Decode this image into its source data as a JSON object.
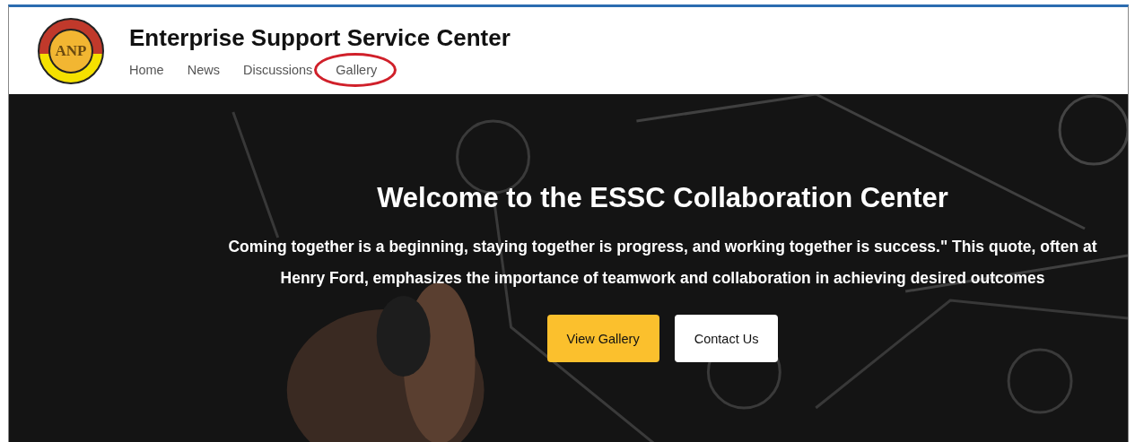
{
  "header": {
    "logo_text": "ANP",
    "title": "Enterprise Support Service Center"
  },
  "nav": [
    {
      "label": "Home",
      "selected": false,
      "circled": false
    },
    {
      "label": "News",
      "selected": false,
      "circled": false
    },
    {
      "label": "Discussions",
      "selected": false,
      "circled": false
    },
    {
      "label": "Gallery",
      "selected": false,
      "circled": true
    }
  ],
  "hero": {
    "kind": "picture",
    "title": "Welcome to the ESSC Collaboration Center",
    "quote_lines": [
      "Coming together is a beginning, staying together is progress, and working together is success.\" This quote, often at",
      "Henry Ford, emphasizes the importance of teamwork and collaboration in achieving desired outcomes"
    ],
    "buttons": [
      {
        "label": "View Gallery",
        "kind": "primary"
      },
      {
        "label": "Contact Us",
        "kind": "secondary"
      }
    ]
  }
}
